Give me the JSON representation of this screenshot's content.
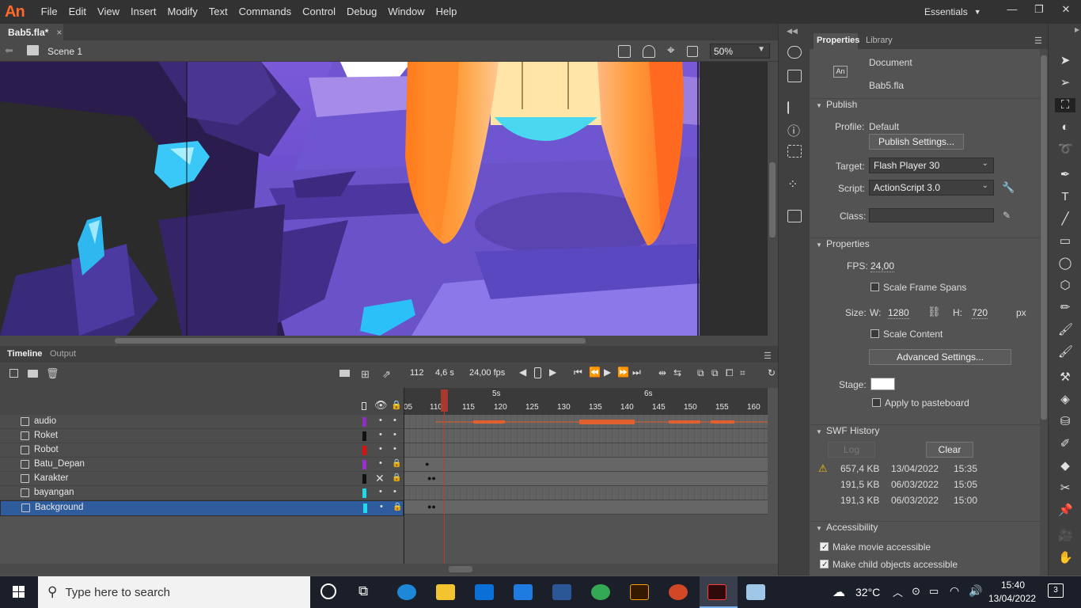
{
  "app": {
    "logo": "An",
    "workspace": "Essentials"
  },
  "menu": [
    "File",
    "Edit",
    "View",
    "Insert",
    "Modify",
    "Text",
    "Commands",
    "Control",
    "Debug",
    "Window",
    "Help"
  ],
  "doc_tab": {
    "title": "Bab5.fla*",
    "close": "×"
  },
  "scene": {
    "name": "Scene 1",
    "zoom": "50%"
  },
  "timeline": {
    "tabs": [
      "Timeline",
      "Output"
    ],
    "frame": "112",
    "time": "4,6 s",
    "fps": "24,00 fps",
    "ruler_marks": [
      "05",
      "110",
      "115",
      "120",
      "125",
      "130",
      "135",
      "140",
      "145",
      "150",
      "155",
      "160"
    ],
    "seconds": [
      "5s",
      "6s"
    ],
    "layers": [
      {
        "name": "audio",
        "color": "#8e2fc0",
        "locked": false,
        "selected": false
      },
      {
        "name": "Roket",
        "color": "#111111",
        "locked": false,
        "selected": false
      },
      {
        "name": "Robot",
        "color": "#e01010",
        "locked": false,
        "selected": false
      },
      {
        "name": "Batu_Depan",
        "color": "#9a2fd0",
        "locked": true,
        "selected": false
      },
      {
        "name": "Karakter",
        "color": "#111111",
        "locked": true,
        "selected": false
      },
      {
        "name": "bayangan",
        "color": "#20d8e8",
        "locked": false,
        "selected": false
      },
      {
        "name": "Background",
        "color": "#20d8f0",
        "locked": true,
        "selected": true
      }
    ]
  },
  "properties": {
    "tabs": [
      "Properties",
      "Library"
    ],
    "doc_type": "Document",
    "doc_icon": "An",
    "file": "Bab5.fla",
    "publish": {
      "heading": "Publish",
      "profile_label": "Profile:",
      "profile": "Default",
      "settings_btn": "Publish Settings...",
      "target_label": "Target:",
      "target": "Flash Player 30",
      "script_label": "Script:",
      "script": "ActionScript 3.0",
      "class_label": "Class:",
      "class_value": ""
    },
    "props": {
      "heading": "Properties",
      "fps_label": "FPS:",
      "fps": "24,00",
      "scale_spans": "Scale Frame Spans",
      "size_label": "Size:",
      "w_label": "W:",
      "w": "1280",
      "h_label": "H:",
      "h": "720",
      "unit": "px",
      "scale_content": "Scale Content",
      "advanced_btn": "Advanced Settings...",
      "stage_label": "Stage:",
      "stage_color": "#ffffff",
      "pasteboard": "Apply to pasteboard"
    },
    "swf": {
      "heading": "SWF History",
      "log_btn": "Log",
      "clear_btn": "Clear",
      "rows": [
        {
          "size": "657,4 KB",
          "date": "13/04/2022",
          "time": "15:35",
          "warn": true
        },
        {
          "size": "191,5 KB",
          "date": "06/03/2022",
          "time": "15:05",
          "warn": false
        },
        {
          "size": "191,3 KB",
          "date": "06/03/2022",
          "time": "15:00",
          "warn": false
        }
      ]
    },
    "access": {
      "heading": "Accessibility",
      "movie": "Make movie accessible",
      "children": "Make child objects accessible"
    }
  },
  "taskbar": {
    "search_placeholder": "Type here to search",
    "temp": "32°C",
    "time": "15:40",
    "date": "13/04/2022",
    "notif": "3"
  }
}
